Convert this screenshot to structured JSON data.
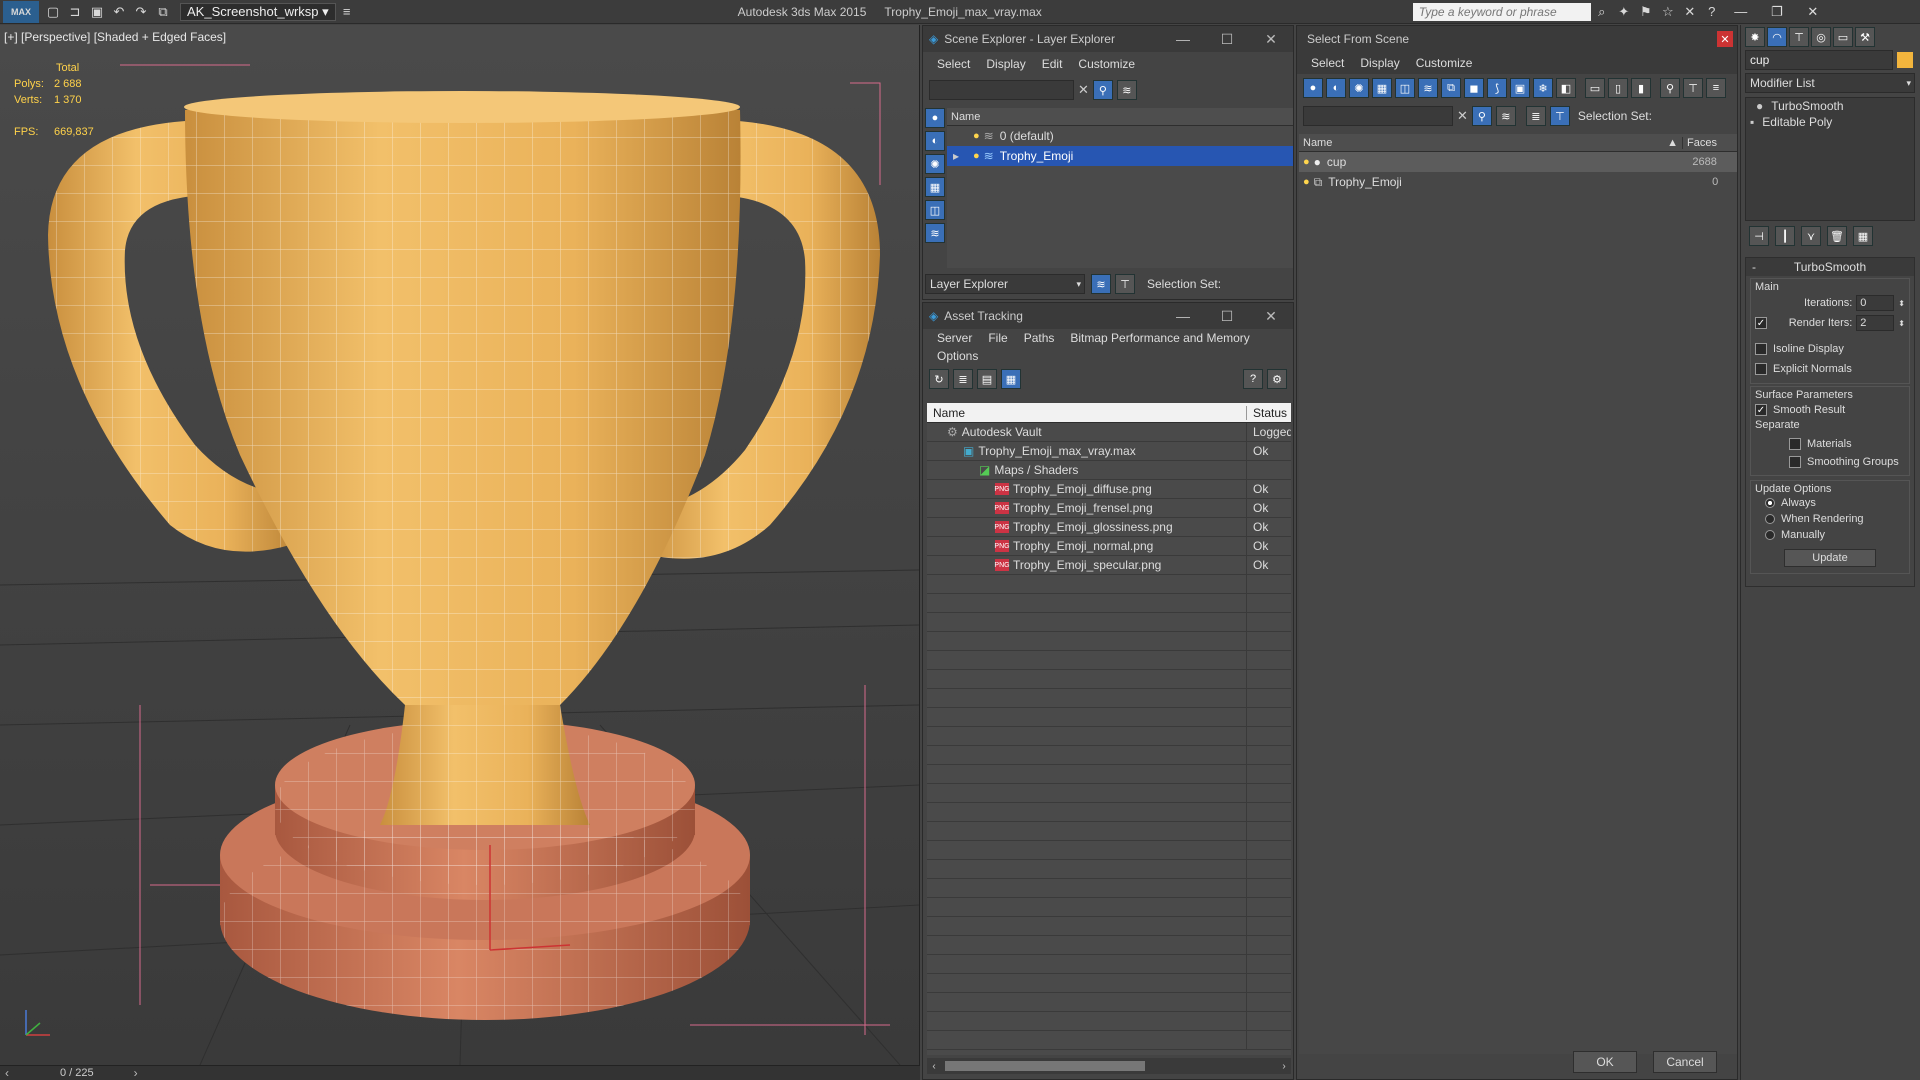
{
  "titlebar": {
    "logo": "MAX",
    "workspace": "AK_Screenshot_wrksp",
    "app_title": "Autodesk 3ds Max  2015",
    "file_title": "Trophy_Emoji_max_vray.max",
    "search_placeholder": "Type a keyword or phrase"
  },
  "viewport": {
    "label": "[+] [Perspective] [Shaded + Edged Faces]",
    "stats": {
      "total_label": "Total",
      "polys_label": "Polys:",
      "polys": "2 688",
      "verts_label": "Verts:",
      "verts": "1 370",
      "fps_label": "FPS:",
      "fps": "669,837"
    },
    "timeline": "0 / 225"
  },
  "layer_explorer": {
    "title": "Scene Explorer - Layer Explorer",
    "menu": [
      "Select",
      "Display",
      "Edit",
      "Customize"
    ],
    "col_name": "Name",
    "rows": [
      "0 (default)",
      "Trophy_Emoji"
    ],
    "footer_dropdown": "Layer Explorer",
    "footer_selset": "Selection Set:"
  },
  "asset_tracking": {
    "title": "Asset Tracking",
    "menu": [
      "Server",
      "File",
      "Paths",
      "Bitmap Performance and Memory"
    ],
    "menu2": "Options",
    "col_name": "Name",
    "col_status": "Status",
    "rows": [
      {
        "name": "Autodesk Vault",
        "status": "Logged"
      },
      {
        "name": "Trophy_Emoji_max_vray.max",
        "status": "Ok"
      },
      {
        "name": "Maps / Shaders",
        "status": ""
      },
      {
        "name": "Trophy_Emoji_diffuse.png",
        "status": "Ok"
      },
      {
        "name": "Trophy_Emoji_frensel.png",
        "status": "Ok"
      },
      {
        "name": "Trophy_Emoji_glossiness.png",
        "status": "Ok"
      },
      {
        "name": "Trophy_Emoji_normal.png",
        "status": "Ok"
      },
      {
        "name": "Trophy_Emoji_specular.png",
        "status": "Ok"
      }
    ]
  },
  "select_from_scene": {
    "title": "Select From Scene",
    "menu": [
      "Select",
      "Display",
      "Customize"
    ],
    "selset": "Selection Set:",
    "col_name": "Name",
    "col_faces": "Faces",
    "rows": [
      {
        "name": "cup",
        "faces": "2688"
      },
      {
        "name": "Trophy_Emoji",
        "faces": "0"
      }
    ],
    "ok": "OK",
    "cancel": "Cancel"
  },
  "command_panel": {
    "object_name": "cup",
    "modifier_list": "Modifier List",
    "stack": [
      "TurboSmooth",
      "Editable Poly"
    ],
    "rollout_title": "TurboSmooth",
    "main_label": "Main",
    "iterations_label": "Iterations:",
    "iterations": "0",
    "render_iters_label": "Render Iters:",
    "render_iters": "2",
    "isoline": "Isoline Display",
    "explicit": "Explicit Normals",
    "surface_label": "Surface Parameters",
    "smooth_result": "Smooth Result",
    "separate": "Separate",
    "materials": "Materials",
    "smoothing_groups": "Smoothing Groups",
    "update_label": "Update Options",
    "always": "Always",
    "when_rendering": "When Rendering",
    "manually": "Manually",
    "update_btn": "Update"
  }
}
